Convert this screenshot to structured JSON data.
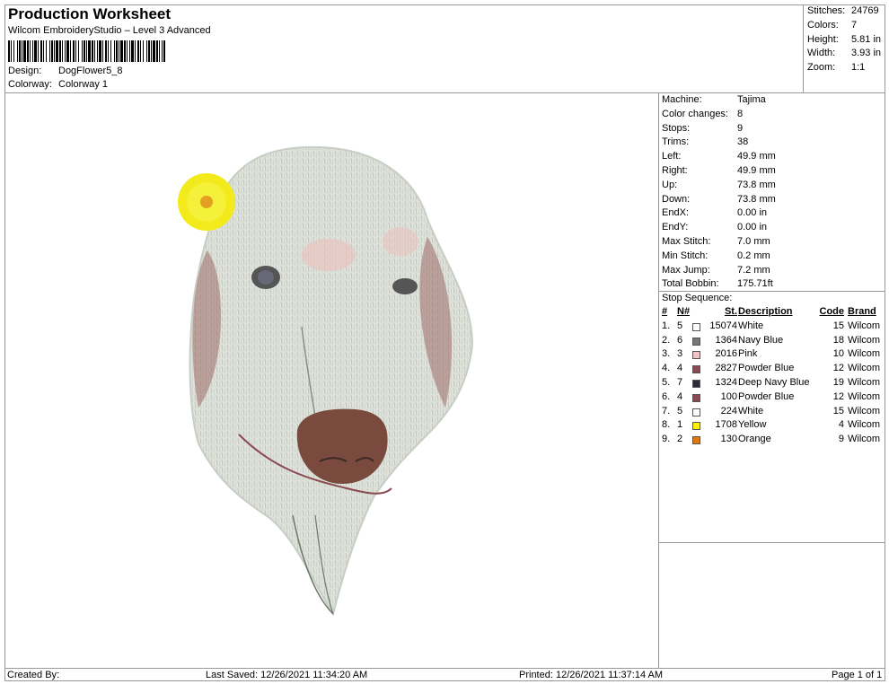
{
  "header": {
    "title": "Production Worksheet",
    "subtitle": "Wilcom EmbroideryStudio – Level 3 Advanced",
    "design_label": "Design:",
    "design_value": "DogFlower5_8",
    "colorway_label": "Colorway:",
    "colorway_value": "Colorway 1"
  },
  "summary": [
    {
      "label": "Stitches:",
      "value": "24769"
    },
    {
      "label": "Colors:",
      "value": "7"
    },
    {
      "label": "Height:",
      "value": "5.81 in"
    },
    {
      "label": "Width:",
      "value": "3.93 in"
    },
    {
      "label": "Zoom:",
      "value": "1:1"
    }
  ],
  "machine_info": [
    {
      "label": "Machine:",
      "value": "Tajima"
    },
    {
      "label": "Color changes:",
      "value": "8"
    },
    {
      "label": "Stops:",
      "value": "9"
    },
    {
      "label": "Trims:",
      "value": "38"
    },
    {
      "label": "Left:",
      "value": "49.9 mm"
    },
    {
      "label": "Right:",
      "value": "49.9 mm"
    },
    {
      "label": "Up:",
      "value": "73.8 mm"
    },
    {
      "label": "Down:",
      "value": "73.8 mm"
    },
    {
      "label": "EndX:",
      "value": "0.00 in"
    },
    {
      "label": "EndY:",
      "value": "0.00 in"
    },
    {
      "label": "Max Stitch:",
      "value": "7.0 mm"
    },
    {
      "label": "Min Stitch:",
      "value": "0.2 mm"
    },
    {
      "label": "Max Jump:",
      "value": "7.2 mm"
    },
    {
      "label": "Total Bobbin:",
      "value": "175.71ft"
    }
  ],
  "stop_sequence": {
    "label": "Stop Sequence:",
    "headers": {
      "idx": "#",
      "n": "N#",
      "st": "St.",
      "desc": "Description",
      "code": "Code",
      "brand": "Brand"
    },
    "rows": [
      {
        "idx": "1.",
        "n": "5",
        "color": "#ffffff",
        "st": "15074",
        "desc": "White",
        "code": "15",
        "brand": "Wilcom"
      },
      {
        "idx": "2.",
        "n": "6",
        "color": "#777777",
        "st": "1364",
        "desc": "Navy Blue",
        "code": "18",
        "brand": "Wilcom"
      },
      {
        "idx": "3.",
        "n": "3",
        "color": "#f3c2c2",
        "st": "2016",
        "desc": "Pink",
        "code": "10",
        "brand": "Wilcom"
      },
      {
        "idx": "4.",
        "n": "4",
        "color": "#8a4a52",
        "st": "2827",
        "desc": "Powder Blue",
        "code": "12",
        "brand": "Wilcom"
      },
      {
        "idx": "5.",
        "n": "7",
        "color": "#2a2a38",
        "st": "1324",
        "desc": "Deep Navy Blue",
        "code": "19",
        "brand": "Wilcom"
      },
      {
        "idx": "6.",
        "n": "4",
        "color": "#8a4a52",
        "st": "100",
        "desc": "Powder Blue",
        "code": "12",
        "brand": "Wilcom"
      },
      {
        "idx": "7.",
        "n": "5",
        "color": "#ffffff",
        "st": "224",
        "desc": "White",
        "code": "15",
        "brand": "Wilcom"
      },
      {
        "idx": "8.",
        "n": "1",
        "color": "#ffef00",
        "st": "1708",
        "desc": "Yellow",
        "code": "4",
        "brand": "Wilcom"
      },
      {
        "idx": "9.",
        "n": "2",
        "color": "#e07a10",
        "st": "130",
        "desc": "Orange",
        "code": "9",
        "brand": "Wilcom"
      }
    ]
  },
  "footer": {
    "created_by": "Created By:",
    "last_saved": "Last Saved: 12/26/2021 11:34:20 AM",
    "printed": "Printed: 12/26/2021 11:37:14 AM",
    "page": "Page 1 of 1"
  },
  "design_image": {
    "icon": "embroidered-dog-with-flower-image"
  }
}
